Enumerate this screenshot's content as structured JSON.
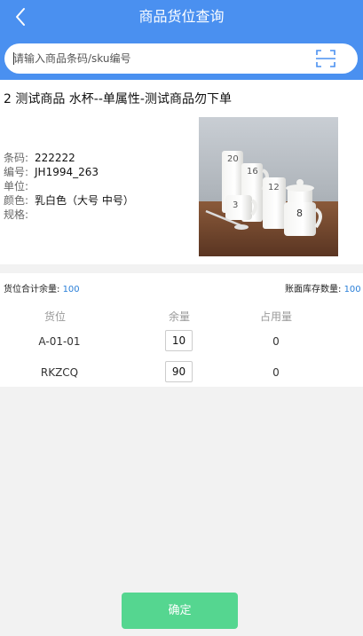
{
  "header": {
    "title": "商品货位查询",
    "back_icon": "chevron-left-icon",
    "bg_color": "#4a90f0"
  },
  "search": {
    "placeholder": "请输入商品条码/sku编号",
    "value": "",
    "scan_icon": "scan-icon"
  },
  "product": {
    "name": "2 测试商品 水杯--单属性-测试商品勿下单",
    "attributes": [
      {
        "key": "条码:",
        "value": "222222"
      },
      {
        "key": "编号:",
        "value": "JH1994_263"
      },
      {
        "key": "单位:",
        "value": ""
      },
      {
        "key": "颜色:",
        "value": "乳白色（大号  中号）"
      },
      {
        "key": "规格:",
        "value": ""
      }
    ]
  },
  "stock": {
    "total_label": "货位合计余量:",
    "total_value": "100",
    "book_label": "账面库存数量:",
    "book_value": "100",
    "columns": [
      "货位",
      "余量",
      "占用量"
    ],
    "rows": [
      {
        "location": "A-01-01",
        "qty": "10",
        "occupied": "0"
      },
      {
        "location": "RKZCQ",
        "qty": "90",
        "occupied": "0"
      }
    ]
  },
  "footer": {
    "confirm_label": "确定",
    "confirm_color": "#55d690"
  }
}
